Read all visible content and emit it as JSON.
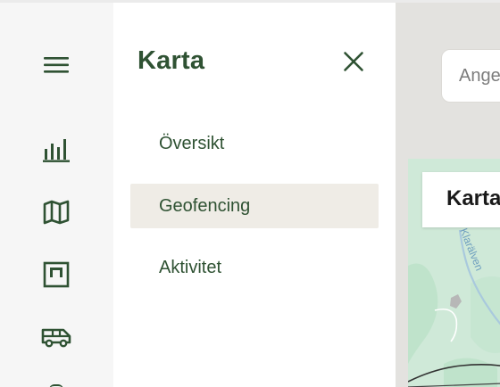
{
  "drawer": {
    "title": "Karta",
    "items": [
      {
        "label": "Översikt",
        "active": false
      },
      {
        "label": "Geofencing",
        "active": true
      },
      {
        "label": "Aktivitet",
        "active": false
      }
    ]
  },
  "rail": {
    "icons": [
      "menu-icon",
      "bar-chart-icon",
      "map-icon",
      "board-icon",
      "van-icon"
    ]
  },
  "search": {
    "placeholder": "Ange"
  },
  "map_card": {
    "title": "Karta",
    "river_label": "Klarälven"
  },
  "colors": {
    "accent": "#2f5233",
    "active_bg": "#efece6",
    "rail_bg": "#f6f6f6",
    "map_green": "#cfe9d8"
  }
}
